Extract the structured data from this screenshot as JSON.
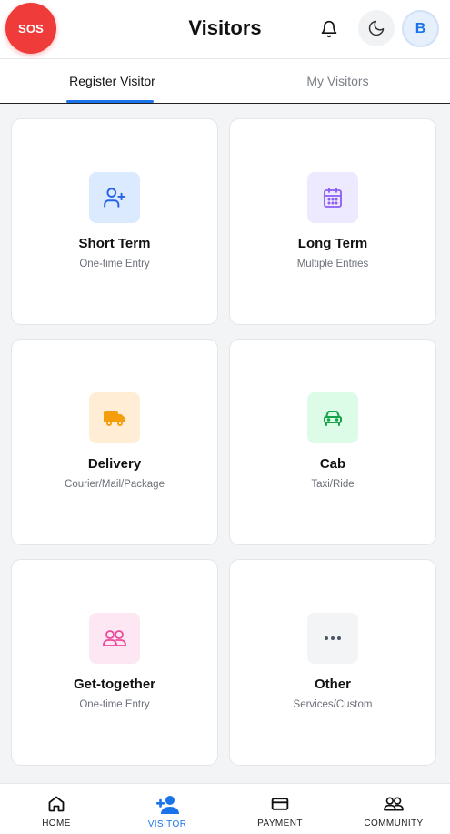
{
  "header": {
    "sos_label": "SOS",
    "title": "Visitors",
    "avatar_initial": "B",
    "bell_icon": "bell-icon",
    "theme_icon": "moon-icon"
  },
  "tabs": [
    {
      "label": "Register Visitor",
      "active": true
    },
    {
      "label": "My Visitors",
      "active": false
    }
  ],
  "cards": [
    {
      "label": "Short Term",
      "sub": "One-time Entry",
      "icon": "user-plus-icon",
      "bg": "#dbeafe",
      "fg": "#2563eb"
    },
    {
      "label": "Long Term",
      "sub": "Multiple Entries",
      "icon": "calendar-icon",
      "bg": "#ede9fe",
      "fg": "#8b5cf6"
    },
    {
      "label": "Delivery",
      "sub": "Courier/Mail/Package",
      "icon": "truck-icon",
      "bg": "#ffedd5",
      "fg": "#f59e0b"
    },
    {
      "label": "Cab",
      "sub": "Taxi/Ride",
      "icon": "car-icon",
      "bg": "#dcfce7",
      "fg": "#16a34a"
    },
    {
      "label": "Get-together",
      "sub": "One-time Entry",
      "icon": "users-icon",
      "bg": "#fce7f3",
      "fg": "#ec4899"
    },
    {
      "label": "Other",
      "sub": "Services/Custom",
      "icon": "more-horizontal-icon",
      "bg": "#f3f4f6",
      "fg": "#4b5563"
    }
  ],
  "bottom_nav": [
    {
      "label": "HOME",
      "icon": "home-icon",
      "active": false
    },
    {
      "label": "VISITOR",
      "icon": "user-plus-icon",
      "active": true
    },
    {
      "label": "PAYMENT",
      "icon": "credit-card-icon",
      "active": false
    },
    {
      "label": "COMMUNITY",
      "icon": "community-icon",
      "active": false
    }
  ],
  "colors": {
    "accent": "#1a73e8",
    "sos": "#f03b3b",
    "background": "#f3f4f6"
  }
}
